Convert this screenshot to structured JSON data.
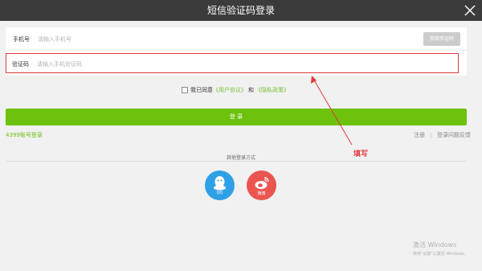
{
  "window": {
    "title": "短信验证码登录",
    "close_icon": "close-icon"
  },
  "form": {
    "phone": {
      "label": "手机号",
      "placeholder": "请输入手机号",
      "button": "获取验证码"
    },
    "code": {
      "label": "验证码",
      "placeholder": "请输入手机验证码"
    }
  },
  "agreement": {
    "prefix": "我已同意",
    "user_agreement": "《用户协议》",
    "conj": "和",
    "privacy_policy": "《隐私政策》"
  },
  "login_button": "登 录",
  "account_login": "4399账号登录",
  "links": {
    "register": "注册",
    "separator": "|",
    "problem": "登录问题反馈"
  },
  "other_login": {
    "title": "其他登录方式",
    "qq": {
      "label": "QQ",
      "icon": "qq-icon",
      "color": "#2ea1e6"
    },
    "weibo": {
      "label": "微博",
      "icon": "weibo-icon",
      "color": "#ea5550"
    }
  },
  "annotation": {
    "text": "填写",
    "color": "#e03a3a"
  },
  "watermark": {
    "line1": "激活 Windows",
    "line2": "转到\"设置\"以激活 Windows。"
  },
  "colors": {
    "accent": "#6cc20c",
    "titlebar": "#3b3b3b",
    "highlight": "#e03a3a"
  }
}
